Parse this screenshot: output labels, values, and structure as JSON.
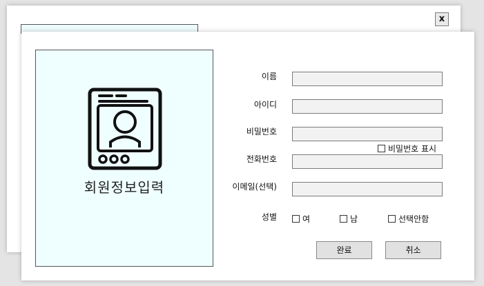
{
  "background_window": {
    "close_label": "x"
  },
  "panel": {
    "icon": "profile-card-icon",
    "title": "회원정보입력"
  },
  "form": {
    "name_label": "이름",
    "id_label": "아이디",
    "password_label": "비밀번호",
    "show_password_label": "비밀번호 표시",
    "phone_label": "전화번호",
    "email_label": "이메일(선택)",
    "gender_label": "성별",
    "gender_options": [
      "여",
      "남",
      "선택안함"
    ]
  },
  "buttons": {
    "confirm_label": "완료",
    "cancel_label": "취소"
  },
  "colors": {
    "panel_background": "#effeff",
    "input_background": "#f2f2f2",
    "button_background": "#e1e1e1"
  }
}
